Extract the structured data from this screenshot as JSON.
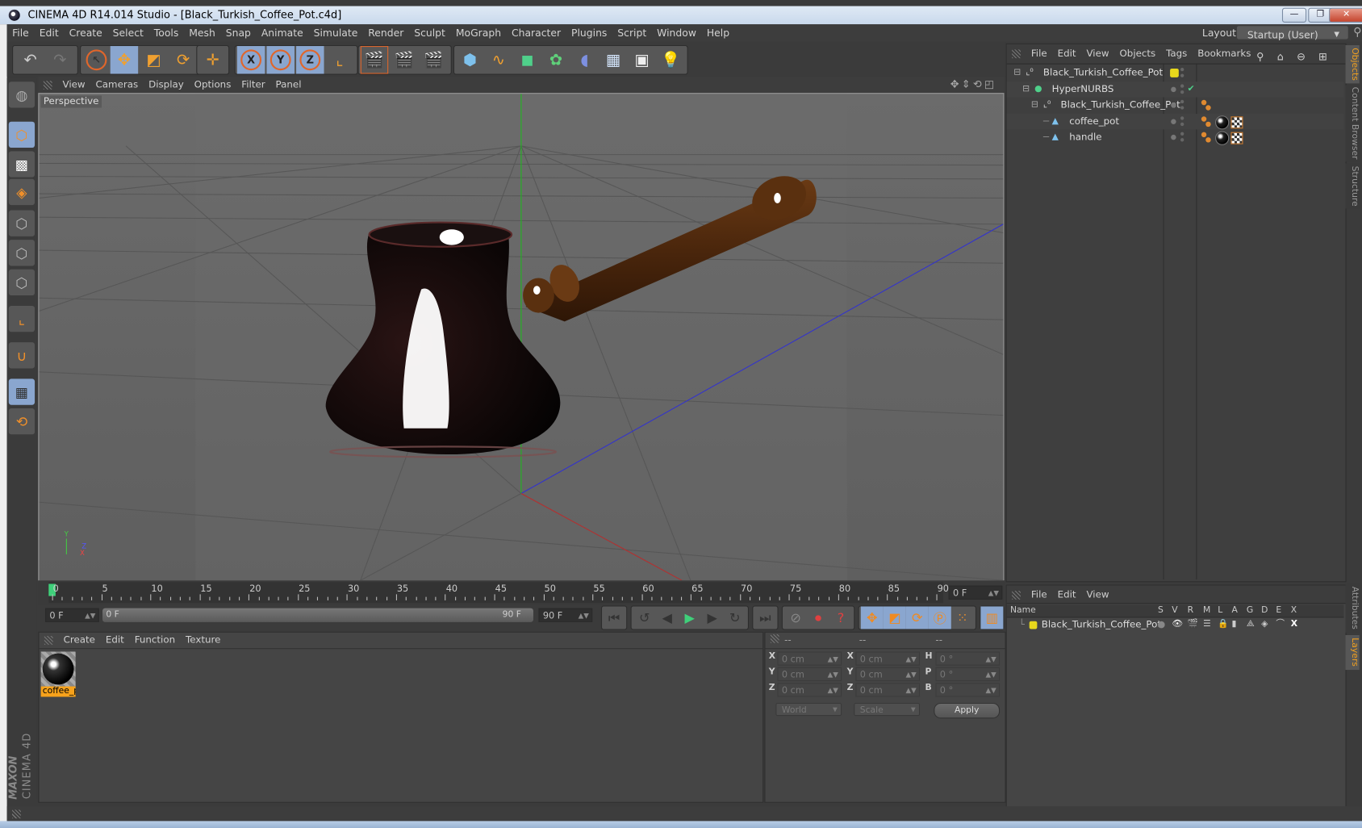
{
  "window": {
    "title": "CINEMA 4D R14.014 Studio - [Black_Turkish_Coffee_Pot.c4d]",
    "controls": {
      "minimize": "—",
      "restore": "❐",
      "close": "✕"
    }
  },
  "menubar": {
    "items": [
      "File",
      "Edit",
      "Create",
      "Select",
      "Tools",
      "Mesh",
      "Snap",
      "Animate",
      "Simulate",
      "Render",
      "Sculpt",
      "MoGraph",
      "Character",
      "Plugins",
      "Script",
      "Window",
      "Help"
    ],
    "layout_label": "Layout:",
    "layout_value": "Startup (User)"
  },
  "toolbar": {
    "groups": [
      {
        "name": "history",
        "tools": [
          "undo-icon",
          "redo-icon"
        ]
      },
      {
        "name": "transform",
        "tools": [
          "live-selection-icon",
          "move-icon",
          "scale-icon",
          "rotate-icon"
        ]
      },
      {
        "name": "recent",
        "tools": [
          "recent-tool-icon"
        ]
      },
      {
        "name": "axis",
        "tools": [
          "x-axis-lock-icon",
          "y-axis-lock-icon",
          "z-axis-lock-icon",
          "coordinate-system-icon"
        ]
      },
      {
        "name": "render",
        "tools": [
          "render-view-icon",
          "render-picture-viewer-icon",
          "render-settings-icon"
        ]
      },
      {
        "name": "create",
        "tools": [
          "cube-primitive-icon",
          "spline-pen-icon",
          "nurbs-icon",
          "array-icon",
          "deformer-icon",
          "floor-icon",
          "camera-icon",
          "light-icon"
        ]
      }
    ],
    "axis_labels": [
      "X",
      "Y",
      "Z"
    ]
  },
  "sidetools": [
    "model-mode-icon",
    "texture-mode-icon",
    "workplane-mode-icon",
    "points-mode-icon",
    "edges-mode-icon",
    "polygons-mode-icon",
    "axis-mode-icon",
    "snap-magnet-icon",
    "locked-workplane-icon",
    "planar-workplane-icon"
  ],
  "viewport": {
    "menu": [
      "View",
      "Cameras",
      "Display",
      "Options",
      "Filter",
      "Panel"
    ],
    "label": "Perspective",
    "nav_icons": [
      "move-view-icon",
      "zoom-view-icon",
      "rotate-view-icon",
      "maximize-view-icon"
    ],
    "axis_gizmo": {
      "y": "Y",
      "z": "Z",
      "x": "X"
    }
  },
  "timeline": {
    "ticks": [
      0,
      5,
      10,
      15,
      20,
      25,
      30,
      35,
      40,
      45,
      50,
      55,
      60,
      65,
      70,
      75,
      80,
      85,
      90
    ],
    "current_frame_field": "0 F",
    "start_field": "0 F",
    "range_start": "0 F",
    "range_end": "90 F",
    "end_field": "90 F",
    "current_frame": 0,
    "max_frame": 90
  },
  "playback": {
    "buttons": [
      "go-to-start-icon",
      "previous-key-icon",
      "previous-frame-icon",
      "play-icon",
      "next-frame-icon",
      "next-key-icon",
      "go-to-end-icon",
      "record-keyframe-icon",
      "autokey-icon",
      "keyframe-selection-icon",
      "move-key-icon",
      "scale-key-icon",
      "rotate-key-icon",
      "parameter-key-icon",
      "point-level-icon",
      "timeline-icon"
    ]
  },
  "materials": {
    "menu": [
      "Create",
      "Edit",
      "Function",
      "Texture"
    ],
    "items": [
      {
        "label": "coffee_p"
      }
    ]
  },
  "coordinates": {
    "headers": [
      "--",
      "--",
      "--"
    ],
    "rows": [
      {
        "l1": "X",
        "v1": "0 cm",
        "l2": "X",
        "v2": "0 cm",
        "l3": "H",
        "v3": "0 °"
      },
      {
        "l1": "Y",
        "v1": "0 cm",
        "l2": "Y",
        "v2": "0 cm",
        "l3": "P",
        "v3": "0 °"
      },
      {
        "l1": "Z",
        "v1": "0 cm",
        "l2": "Z",
        "v2": "0 cm",
        "l3": "B",
        "v3": "0 °"
      }
    ],
    "space_dropdown": "World",
    "mode_dropdown": "Scale",
    "apply": "Apply"
  },
  "objects": {
    "menu": [
      "File",
      "Edit",
      "View",
      "Objects",
      "Tags",
      "Bookmarks"
    ],
    "tree": [
      {
        "name": "Black_Turkish_Coffee_Pot",
        "type": "null",
        "depth": 0,
        "expander": "⊟",
        "layer_color": "#e8d81c"
      },
      {
        "name": "HyperNURBS",
        "type": "hypernurbs",
        "depth": 1,
        "expander": "⊟",
        "enabled": "✔"
      },
      {
        "name": "Black_Turkish_Coffee_Pot",
        "type": "null",
        "depth": 2,
        "expander": "⊟"
      },
      {
        "name": "coffee_pot",
        "type": "polygon",
        "depth": 3,
        "expander": ""
      },
      {
        "name": "handle",
        "type": "polygon",
        "depth": 3,
        "expander": ""
      }
    ]
  },
  "layers": {
    "menu": [
      "File",
      "Edit",
      "View"
    ],
    "columns": [
      "Name",
      "S",
      "V",
      "R",
      "M",
      "L",
      "A",
      "G",
      "D",
      "E",
      "X"
    ],
    "rows": [
      {
        "name": "Black_Turkish_Coffee_Pot",
        "color": "#e8d81c"
      }
    ]
  },
  "right_tabs": {
    "top": [
      {
        "label": "Objects",
        "active": true
      },
      {
        "label": "Content Browser",
        "active": false
      },
      {
        "label": "Structure",
        "active": false
      }
    ],
    "bottom": [
      {
        "label": "Attributes",
        "active": false
      },
      {
        "label": "Layers",
        "active": true
      }
    ]
  },
  "logo": {
    "line1": "MAXON",
    "line2": "CINEMA 4D"
  },
  "colors": {
    "accent": "#f0a030",
    "selection": "#8aa6cf",
    "playhead": "#3fd07a",
    "layer_yellow": "#e8d81c"
  }
}
